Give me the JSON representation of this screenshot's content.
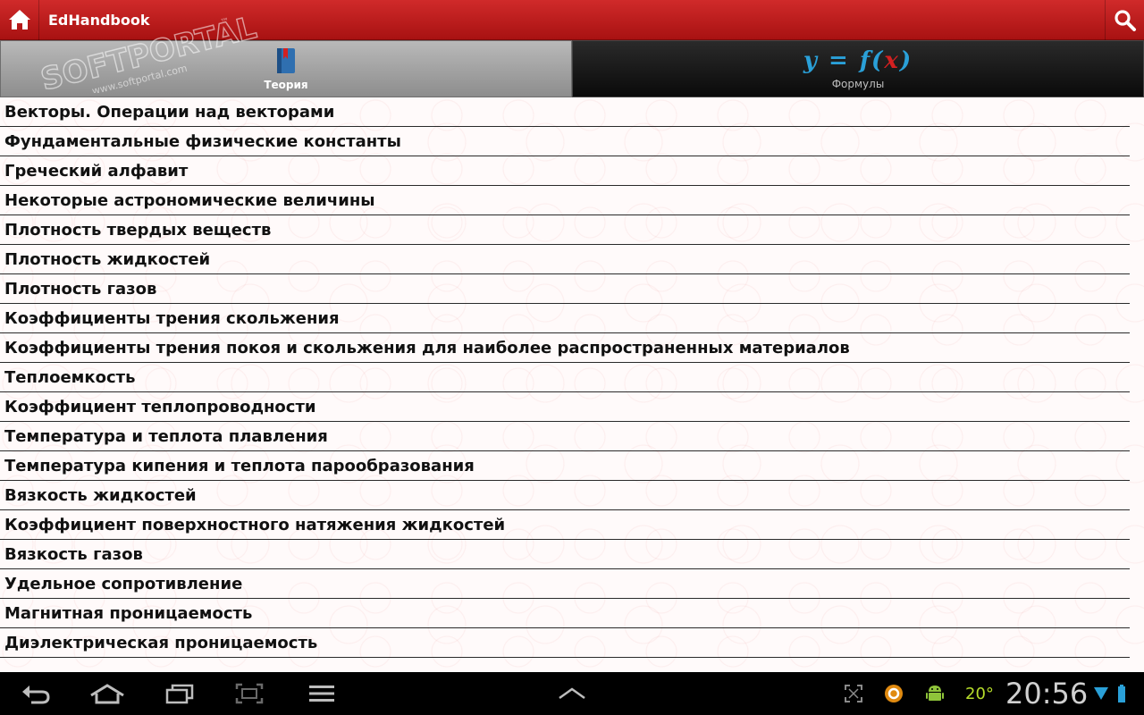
{
  "app": {
    "title": "EdHandbook"
  },
  "tabs": [
    {
      "label": "Теория",
      "active": true
    },
    {
      "label": "Формулы",
      "active": false,
      "formula": {
        "left": "y = f(",
        "var": "x",
        "right": ")"
      }
    }
  ],
  "watermark": {
    "brand": "SOFTPORTAL",
    "url": "www.softportal.com",
    "tm": "™"
  },
  "list": [
    "Векторы. Операции над векторами",
    "Фундаментальные физические константы",
    "Греческий алфавит",
    "Некоторые астрономические величины",
    "Плотность твердых веществ",
    "Плотность жидкостей",
    "Плотность газов",
    "Коэффициенты трения скольжения",
    "Коэффициенты трения покоя и скольжения для наиболее распространенных материалов",
    "Теплоемкость",
    "Коэффициент теплопроводности",
    "Температура и теплота плавления",
    "Температура кипения и теплота парообразования",
    "Вязкость жидкостей",
    "Коэффициент поверхностного натяжения жидкостей",
    "Вязкость газов",
    "Удельное сопротивление",
    "Магнитная проницаемость",
    "Диэлектрическая проницаемость"
  ],
  "system_bar": {
    "temperature": "20°",
    "time": "20:56"
  },
  "colors": {
    "action_bar": "#c01c1c",
    "accent_blue": "#2aa0d8",
    "accent_red": "#d42020"
  }
}
